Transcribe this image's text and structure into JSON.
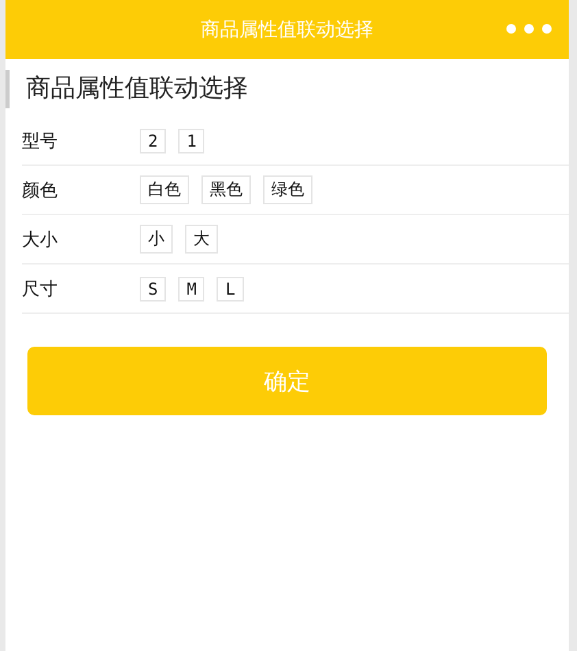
{
  "navbar": {
    "title": "商品属性值联动选择"
  },
  "heading": "商品属性值联动选择",
  "attributes": [
    {
      "name": "型号",
      "values": [
        "2",
        "1"
      ]
    },
    {
      "name": "颜色",
      "values": [
        "白色",
        "黑色",
        "绿色"
      ]
    },
    {
      "name": "大小",
      "values": [
        "小",
        "大"
      ]
    },
    {
      "name": "尺寸",
      "values": [
        "S",
        "M",
        "L"
      ]
    }
  ],
  "confirm_button": "确定"
}
